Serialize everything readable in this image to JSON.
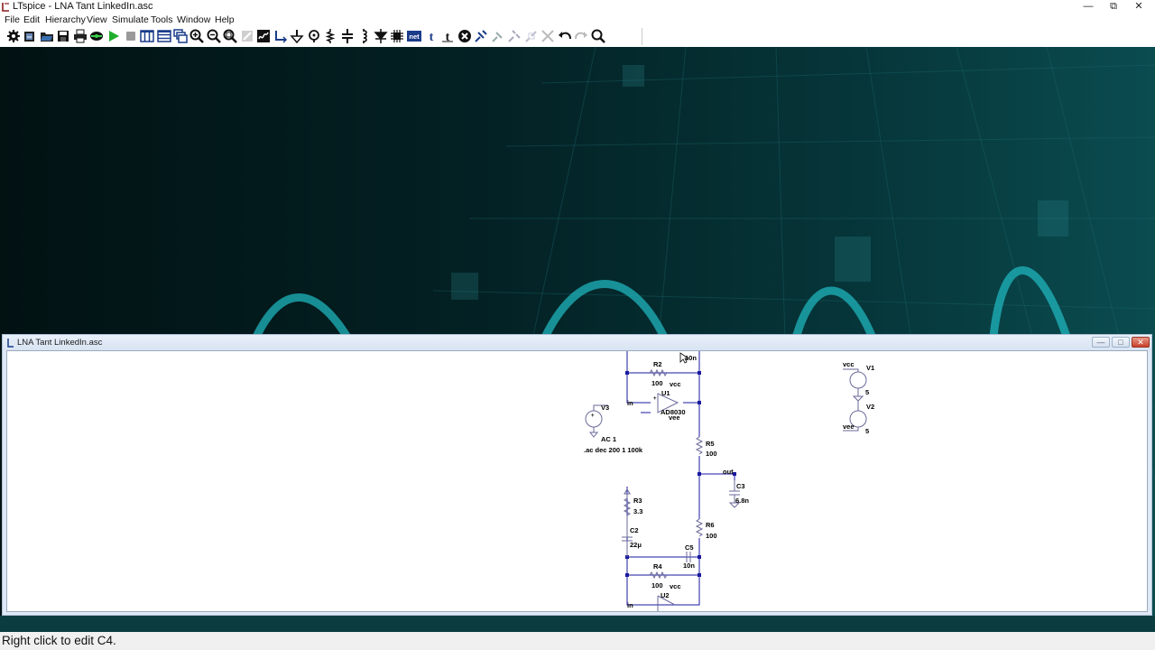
{
  "window": {
    "title": "LTspice - LNA Tant LinkedIn.asc",
    "minimize": "—",
    "restore": "⧉",
    "close": "✕"
  },
  "menu": [
    "File",
    "Edit",
    "Hierarchy",
    "View",
    "Simulate",
    "Tools",
    "Window",
    "Help"
  ],
  "toolbar": {
    "icons": [
      "control-panel-icon",
      "new-schematic-icon",
      "open-icon",
      "save-icon",
      "print-icon",
      "run-icon",
      "halt-icon",
      "tile-vertical-icon",
      "tile-horizontal-icon",
      "cascade-icon",
      "pan-icon",
      "zoom-in-icon",
      "zoom-out-icon",
      "zoom-fit-icon",
      "autorange-icon",
      "spice-directive-icon",
      "wire-icon",
      "ground-icon",
      "label-net-icon",
      "resistor-icon",
      "capacitor-icon",
      "inductor-icon",
      "diode-icon",
      "component-icon",
      "net-name-icon",
      "text-icon",
      "move-icon",
      "delete-icon",
      "duplicate-icon",
      "drag-icon",
      "rotate-icon",
      "mirror-icon",
      "undo-icon",
      "redo-icon",
      "find-icon"
    ]
  },
  "schematic_window": {
    "title": "LNA Tant LinkedIn.asc",
    "minimize": "—",
    "restore": "□",
    "close": "✕"
  },
  "schematic": {
    "labels": {
      "r2": "R2",
      "r2v": "100",
      "u1": "U1",
      "vcc1": "vcc",
      "in1": "in",
      "ad8030": "AD8030",
      "vee1": "vee",
      "v3": "V3",
      "ac1": "AC 1",
      "acdir": ".ac dec 200 1 100k",
      "r5": "R5",
      "r5v": "100",
      "out": "out",
      "c3": "C3",
      "c3v": "6.8n",
      "r3": "R3",
      "r3v": "3.3",
      "c2": "C2",
      "c2v": "22μ",
      "r6": "R6",
      "r6v": "100",
      "c5": "C5",
      "c5v": "10n",
      "r4": "R4",
      "r4v": "100",
      "vcc2": "vcc",
      "in2": "in",
      "u2": "U2",
      "topval": "10n",
      "vccv1": "vcc",
      "v1": "V1",
      "v1v": "5",
      "v2": "V2",
      "v2v": "5",
      "vee2": "vee"
    }
  },
  "status": {
    "text": "Right click to edit C4."
  }
}
